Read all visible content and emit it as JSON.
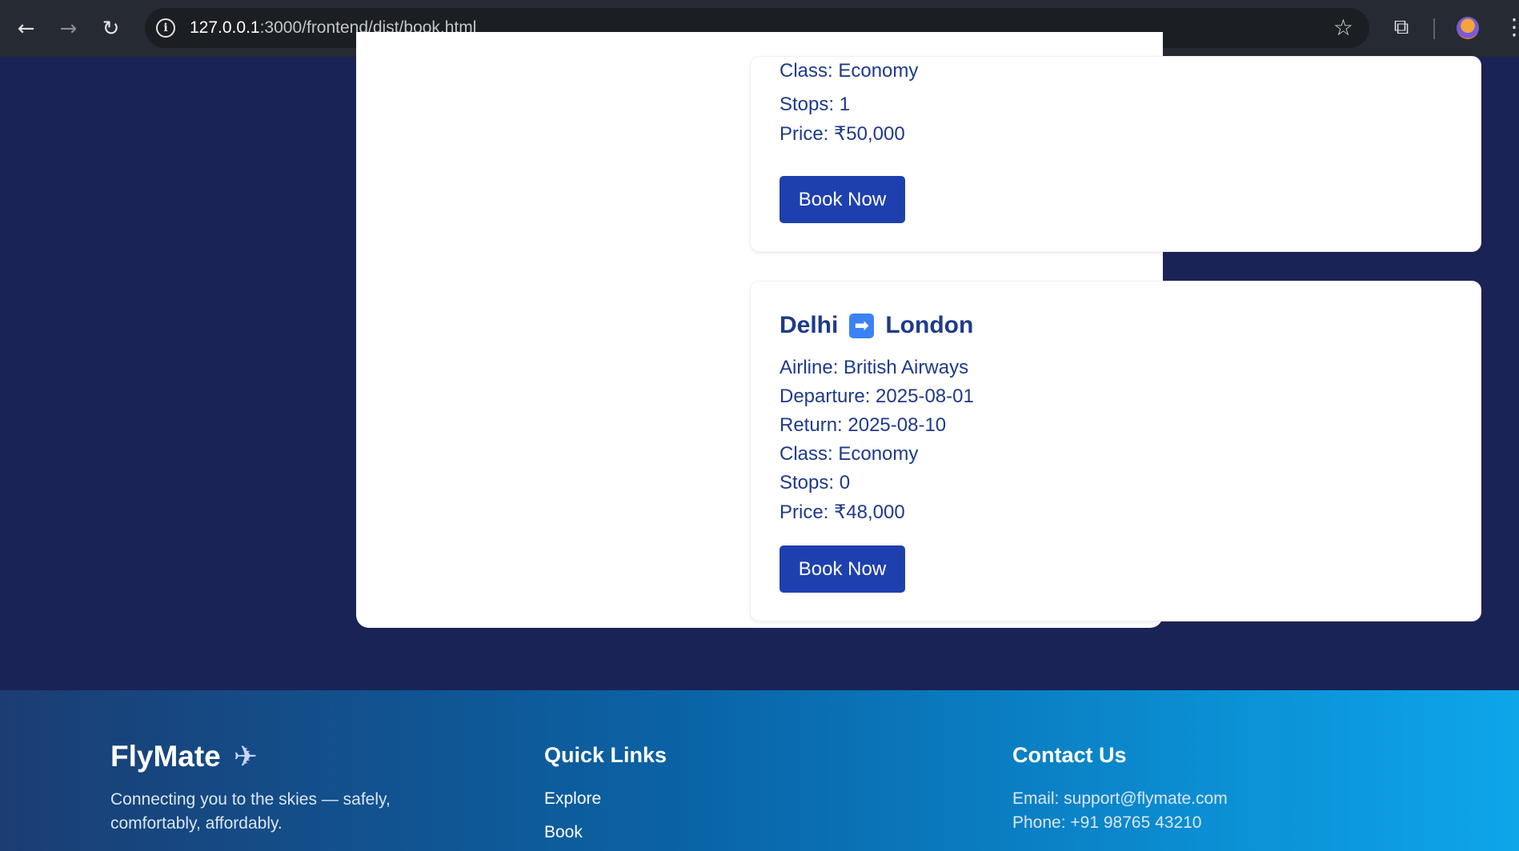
{
  "browser": {
    "url_host": "127.0.0.1",
    "url_path": ":3000/frontend/dist/book.html",
    "icons": [
      "back-arrow-icon",
      "forward-arrow-icon",
      "reload-icon",
      "info-icon",
      "star-icon",
      "extensions-icon",
      "profile-icon",
      "menu-icon"
    ]
  },
  "flights": [
    {
      "partial_line": "Class: Economy",
      "stops": "Stops: 1",
      "price": "Price: ₹50,000",
      "button": "Book Now"
    },
    {
      "from": "Delhi",
      "to": "London",
      "airline": "Airline: British Airways",
      "departure": "Departure: 2025-08-01",
      "return": "Return: 2025-08-10",
      "class": "Class: Economy",
      "stops": "Stops: 0",
      "price": "Price: ₹48,000",
      "button": "Book Now"
    }
  ],
  "footer": {
    "brand": "FlyMate",
    "tagline": "Connecting you to the skies — safely, comfortably, affordably.",
    "quick_links_title": "Quick Links",
    "quick_links": [
      "Explore",
      "Book"
    ],
    "contact_title": "Contact Us",
    "email": "Email: support@flymate.com",
    "phone": "Phone: +91 98765 43210"
  },
  "colors": {
    "page_background": "#1a2355",
    "heading": "#1e3a8a",
    "button": "#1e40af"
  }
}
